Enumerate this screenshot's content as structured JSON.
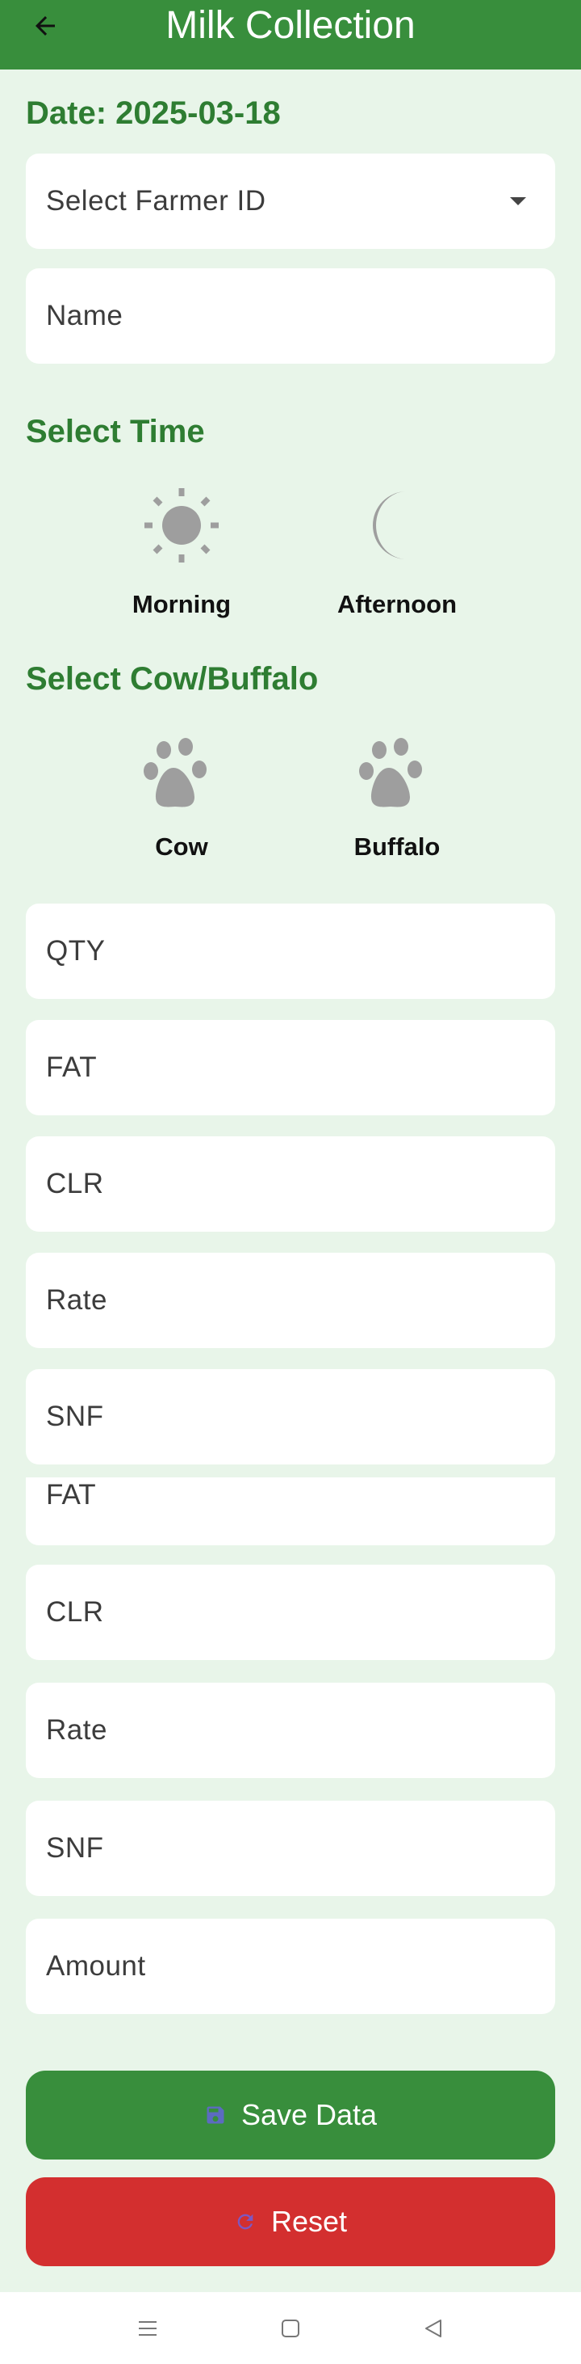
{
  "app_bar": {
    "title": "Milk Collection",
    "back_icon": "arrow-back-icon",
    "color": "#388e3c"
  },
  "date_label": "Date: 2025-03-18",
  "farmer_select": {
    "placeholder": "Select Farmer ID"
  },
  "name_field": {
    "placeholder": "Name"
  },
  "time_section": {
    "title": "Select Time",
    "options": [
      {
        "label": "Morning",
        "icon": "sun-icon"
      },
      {
        "label": "Afternoon",
        "icon": "moon-icon"
      }
    ]
  },
  "animal_section": {
    "title": "Select Cow/Buffalo",
    "options": [
      {
        "label": "Cow",
        "icon": "paw-icon"
      },
      {
        "label": "Buffalo",
        "icon": "paw-icon"
      }
    ]
  },
  "fields_primary": [
    "QTY",
    "FAT",
    "CLR",
    "Rate",
    "SNF"
  ],
  "fields_secondary": [
    "FAT",
    "CLR",
    "Rate",
    "SNF",
    "Amount"
  ],
  "buttons": {
    "save_label": "Save Data",
    "save_icon": "save-icon",
    "reset_label": "Reset",
    "reset_icon": "refresh-icon",
    "save_color": "#388e3c",
    "reset_color": "#d32f2f"
  },
  "system_nav": {
    "items": [
      "menu-icon",
      "home-square-icon",
      "back-triangle-icon"
    ]
  }
}
